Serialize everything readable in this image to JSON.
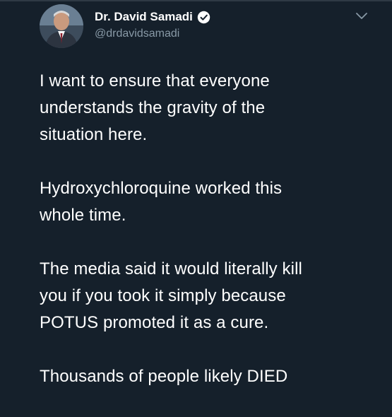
{
  "author": {
    "display_name": "Dr. David Samadi",
    "handle": "@drdavidsamadi",
    "verified": true,
    "avatar_icon": "profile-photo"
  },
  "menu_icon": "chevron-down-icon",
  "tweet": {
    "paragraphs": [
      "I want to ensure that everyone\nunderstands the gravity of the\nsituation here.",
      "Hydroxychloroquine worked this\nwhole time.",
      "The media said it would literally kill\nyou if you took it simply because\nPOTUS promoted it as a cure.",
      "Thousands of people likely DIED"
    ]
  },
  "colors": {
    "background": "#15202b",
    "text": "#ffffff",
    "secondary_text": "#8899a6",
    "verified_badge": "#ffffff"
  }
}
